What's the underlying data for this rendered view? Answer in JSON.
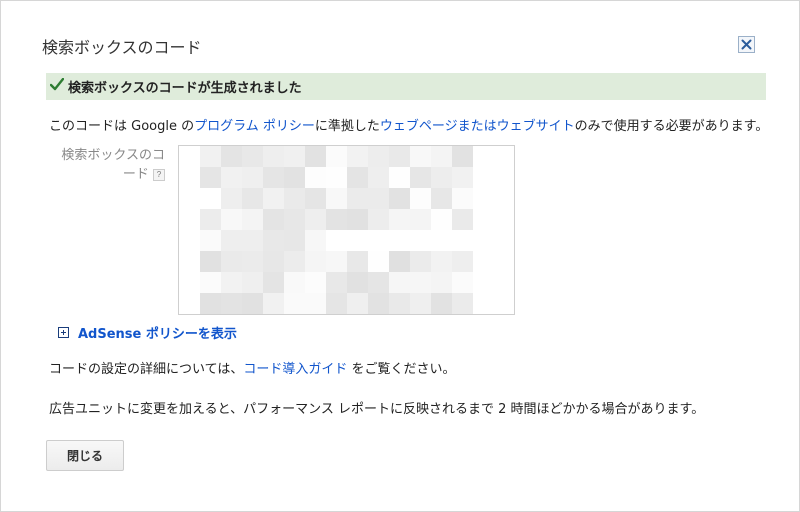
{
  "dialog": {
    "title": "検索ボックスのコード",
    "close_icon": "close-x-icon"
  },
  "success": {
    "icon": "checkmark-icon",
    "message": "検索ボックスのコードが生成されました"
  },
  "policy_line": {
    "prefix": "このコードは Google の",
    "link1": "プログラム ポリシー",
    "middle": "に準拠した",
    "link2": "ウェブページまたはウェブサイト",
    "suffix": "のみで使用する必要があります。"
  },
  "code_field": {
    "label": "検索ボックスのコード",
    "help": "?",
    "value": ""
  },
  "adsense_policy": {
    "label": "AdSense ポリシーを表示",
    "icon": "plus-expand-icon"
  },
  "guide_line": {
    "prefix": "コードの設定の詳細については、",
    "link": "コード導入ガイド",
    "suffix": " をご覧ください。"
  },
  "update_line": "広告ユニットに変更を加えると、パフォーマンス レポートに反映されるまで 2 時間ほどかかる場合があります。",
  "buttons": {
    "close": "閉じる"
  }
}
